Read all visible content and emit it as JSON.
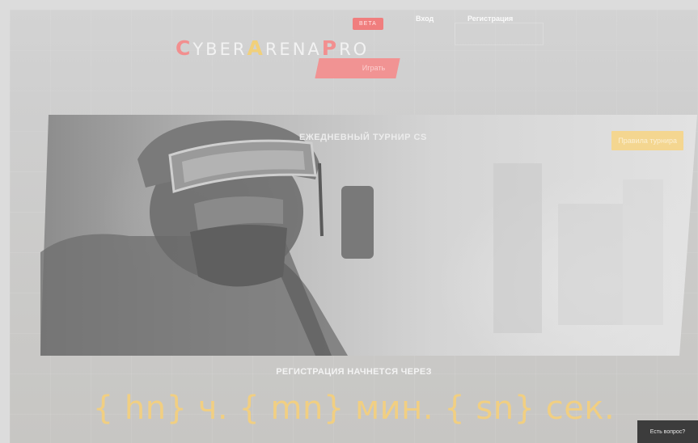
{
  "header": {
    "logo": {
      "cap1": "C",
      "part1": "YBER",
      "cap2": "A",
      "part2": "RENA",
      "cap3": "P",
      "part3": "RO"
    },
    "beta_badge": "BETA",
    "nav": {
      "login": "Вход",
      "register": "Регистрация"
    },
    "play_button": "Играть"
  },
  "hero": {
    "title": "ЕЖЕДНЕВНЫЙ ТУРНИР CS",
    "rules_button": "Правила турнира"
  },
  "registration": {
    "title": "РЕГИСТРАЦИЯ НАЧНЕТСЯ ЧЕРЕЗ",
    "timer_text": "{ hn} ч. { mn} мин. { sn} сек."
  },
  "help_button": "Есть вопрос?",
  "colors": {
    "accent_red": "#f07e7e",
    "accent_yellow": "#f4d690",
    "timer": "#f1cf82"
  }
}
